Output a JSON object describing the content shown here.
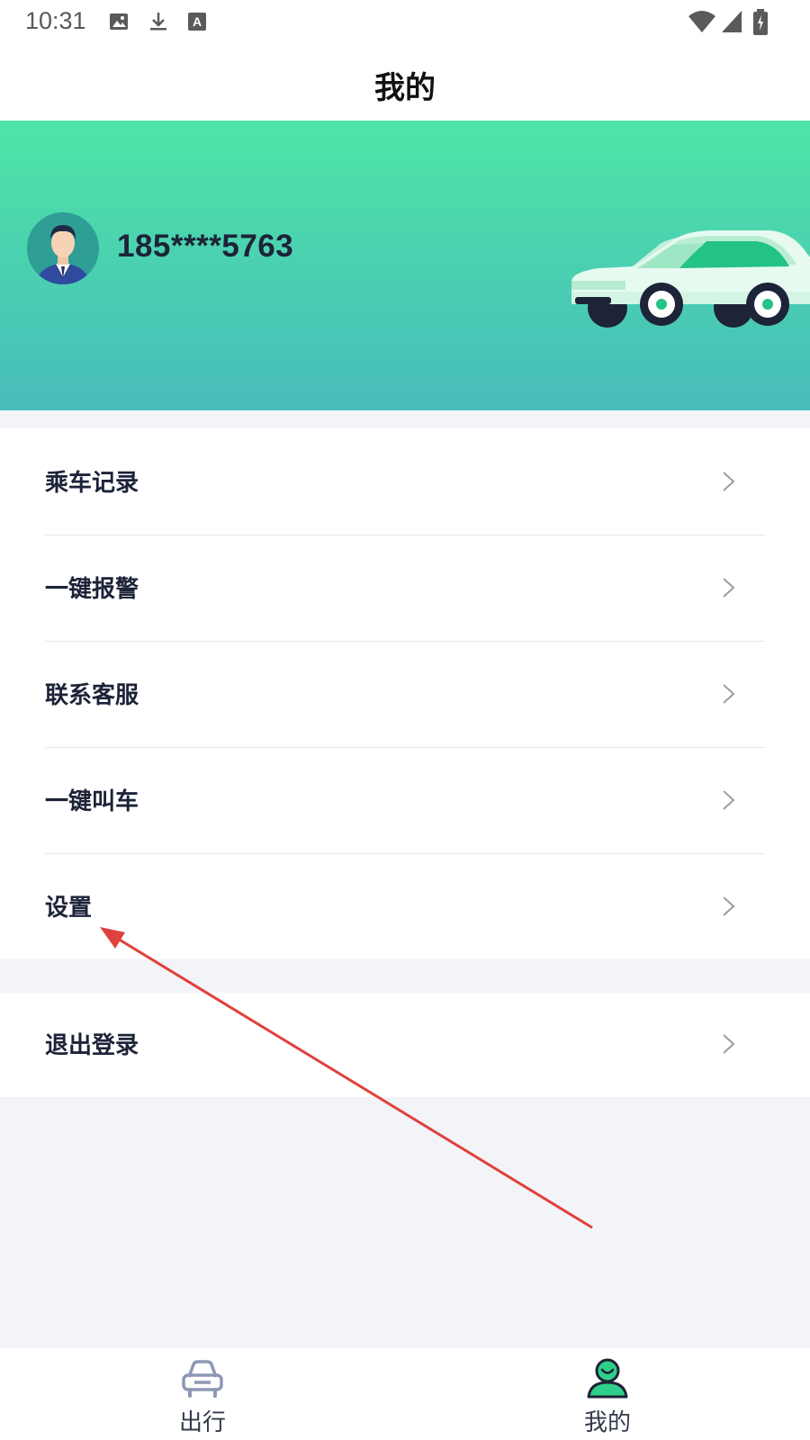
{
  "status_bar": {
    "time": "10:31",
    "icons_left": [
      "image-icon",
      "download-icon",
      "font-a-icon"
    ],
    "icons_right": [
      "wifi-icon",
      "signal-icon",
      "battery-icon"
    ]
  },
  "header": {
    "title": "我的"
  },
  "profile": {
    "phone": "185****5763",
    "avatar": "avatar-man-icon",
    "banner_gradient_top": "#4ee5a6",
    "banner_gradient_bottom": "#47bcbb"
  },
  "menu": {
    "items": [
      {
        "label": "乘车记录"
      },
      {
        "label": "一键报警"
      },
      {
        "label": "联系客服"
      },
      {
        "label": "一键叫车"
      },
      {
        "label": "设置"
      }
    ],
    "logout_label": "退出登录"
  },
  "tabs": [
    {
      "label": "出行",
      "icon": "car-front-icon",
      "active": false
    },
    {
      "label": "我的",
      "icon": "user-icon",
      "active": true
    }
  ],
  "colors": {
    "accent": "#2ecf8b",
    "annotation": "#e0413d"
  }
}
